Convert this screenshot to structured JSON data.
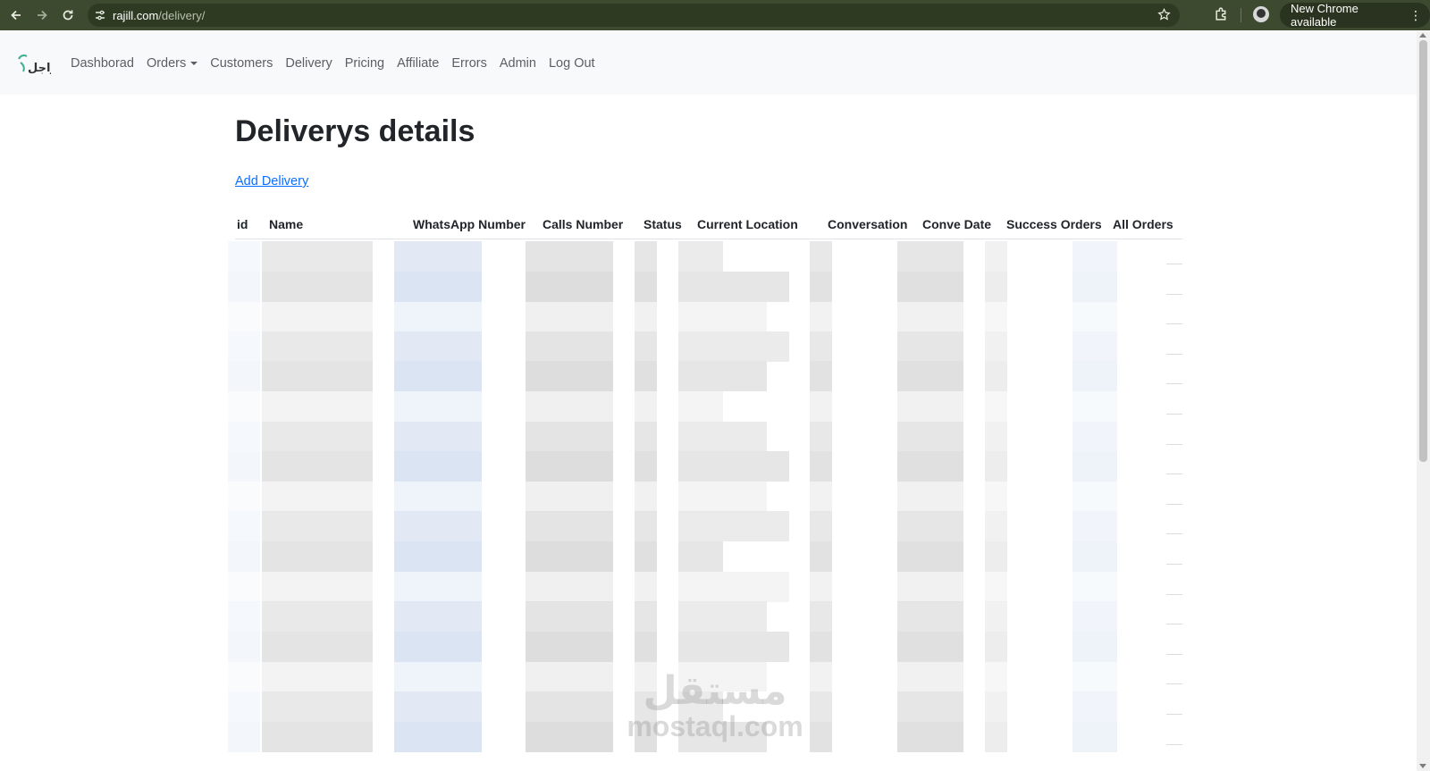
{
  "browser": {
    "url_host": "rajill.com",
    "url_path": "/delivery/",
    "update_label": "New Chrome available"
  },
  "nav": {
    "links": [
      "Dashborad",
      "Orders",
      "Customers",
      "Delivery",
      "Pricing",
      "Affiliate",
      "Errors",
      "Admin",
      "Log Out"
    ]
  },
  "page": {
    "title": "Deliverys details",
    "add_link": "Add Delivery"
  },
  "table": {
    "headers": [
      "id",
      "Name",
      "WhatsApp Number",
      "Calls Number",
      "Status",
      "Current Location",
      "Conversation",
      "Conve Date",
      "Success Orders",
      "All Orders"
    ],
    "row_count": 17,
    "rows_obscured": true
  },
  "watermark": {
    "arabic": "مستقل",
    "latin": "mostaql.com"
  },
  "colors": {
    "browser_bar": "#3d4a2f",
    "nav_bg": "#f8f9fa",
    "link": "#0d6efd",
    "text": "#212529"
  }
}
